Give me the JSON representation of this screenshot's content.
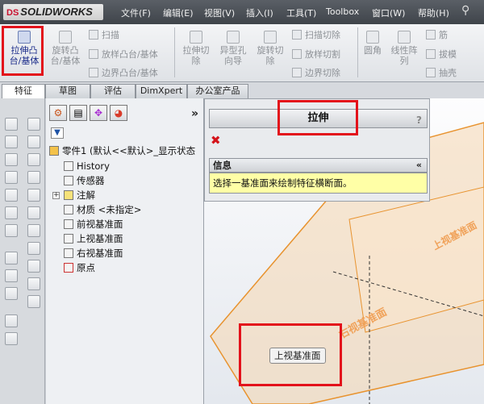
{
  "app": {
    "logo_ds": "DS",
    "logo_text": "SOLIDWORKS"
  },
  "menu": [
    "文件(F)",
    "编辑(E)",
    "视图(V)",
    "插入(I)",
    "工具(T)",
    "Toolbox",
    "窗口(W)",
    "帮助(H)"
  ],
  "commands": {
    "extrude_boss": "拉伸凸\n台/基体",
    "revolve_boss": "旋转凸\n台/基体",
    "sweep": "扫描",
    "loft": "放样凸台/基体",
    "boundary_boss": "边界凸台/基体",
    "extrude_cut": "拉伸切\n除",
    "hole_wizard": "异型孔\n向导",
    "revolve_cut": "旋转切\n除",
    "swept_cut": "扫描切除",
    "lofted_cut": "放样切割",
    "boundary_cut": "边界切除",
    "fillet": "圆角",
    "linear_pattern": "线性阵\n列",
    "rib": "筋",
    "draft": "拔模",
    "shell": "抽壳"
  },
  "tabs": [
    "特征",
    "草图",
    "评估",
    "DimXpert",
    "办公室产品"
  ],
  "feature_tree": {
    "more": "»",
    "part": "零件1  (默认<<默认>_显示状态",
    "items": [
      "History",
      "传感器",
      "注解",
      "材质 <未指定>",
      "前视基准面",
      "上视基准面",
      "右视基准面",
      "原点"
    ]
  },
  "property_manager": {
    "title": "拉伸",
    "help": "?",
    "cancel": "✖",
    "info_header": "信息",
    "info_caret": "«",
    "info_text": "选择一基准面来绘制特征横断面。"
  },
  "graphics": {
    "plane_front_label": "上视基准面",
    "plane_top_label": "右视基准面",
    "tooltip": "上视基准面"
  },
  "colors": {
    "highlight": "#e3121b",
    "plane": "#e8932f",
    "plane_fill": "#f6d7b0"
  }
}
